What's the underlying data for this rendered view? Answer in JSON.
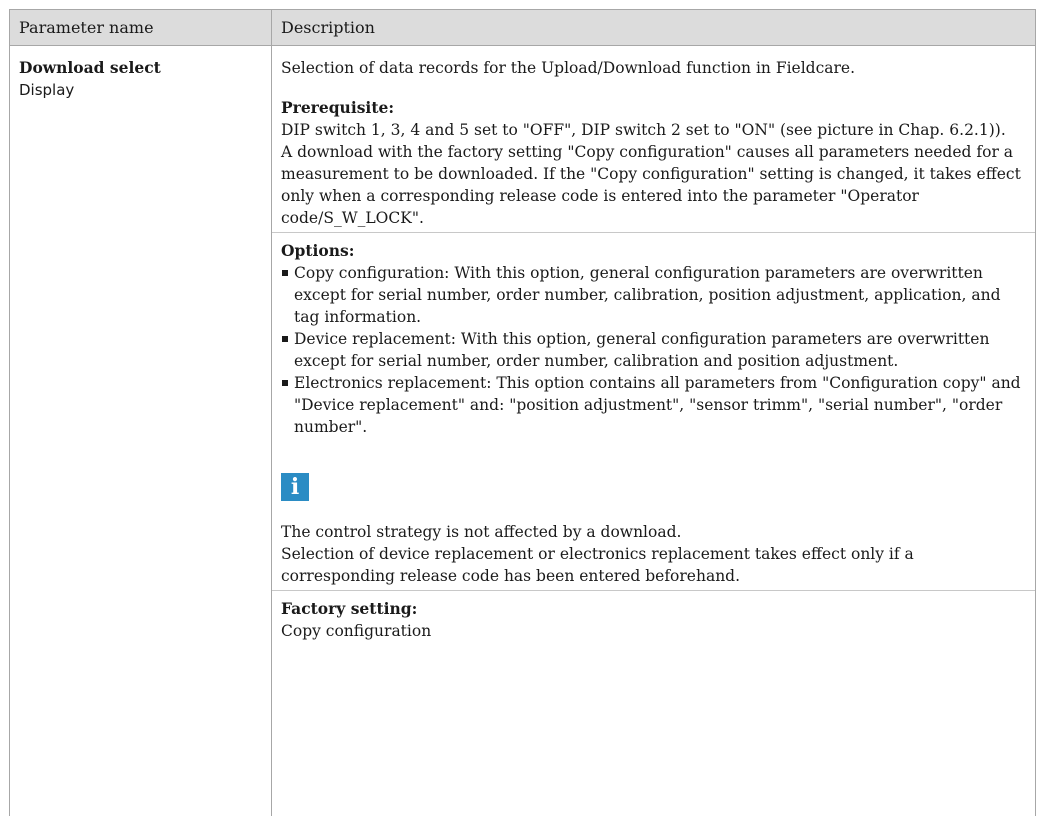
{
  "table": {
    "headers": {
      "name": "Parameter name",
      "description": "Description"
    },
    "row": {
      "name": "Download select",
      "access": "Display",
      "intro": "Selection of data records for the Upload/Download function in Fieldcare.",
      "prerequisite": {
        "title": "Prerequisite:",
        "lines": [
          "DIP switch 1, 3, 4 and 5 set to \"OFF\", DIP switch 2 set to \"ON\" (see picture in Chap. 6.2.1)).",
          "A download with the factory setting \"Copy configuration\" causes all parameters needed for a measurement to be downloaded. If the \"Copy configuration\" setting is changed, it takes effect only when a corresponding release code is entered into the parameter \"Operator code/S_W_LOCK\"."
        ]
      },
      "options": {
        "title": "Options:",
        "items": [
          "Copy configuration: With this option, general configuration parameters are overwritten except for serial number, order number, calibration, position adjustment, application, and tag information.",
          "Device replacement: With this option, general configuration parameters are overwritten except for serial number, order number, calibration and position adjustment.",
          "Electronics replacement: This option contains all parameters from \"Configuration copy\" and \"Device replacement\" and: \"position adjustment\", \"sensor trimm\", \"serial number\", \"order number\"."
        ]
      },
      "info_icon": "info-icon",
      "note_lines": [
        "The control strategy is not affected by a download.",
        "Selection of device replacement or electronics replacement takes effect only if a corresponding release code has been entered beforehand."
      ],
      "factory_setting": {
        "title": "Factory setting:",
        "value": "Copy configuration"
      }
    }
  },
  "colors": {
    "header_bg": "#dcdcdc",
    "border": "#a7a7a7",
    "info_icon_bg": "#2b8cc4"
  }
}
